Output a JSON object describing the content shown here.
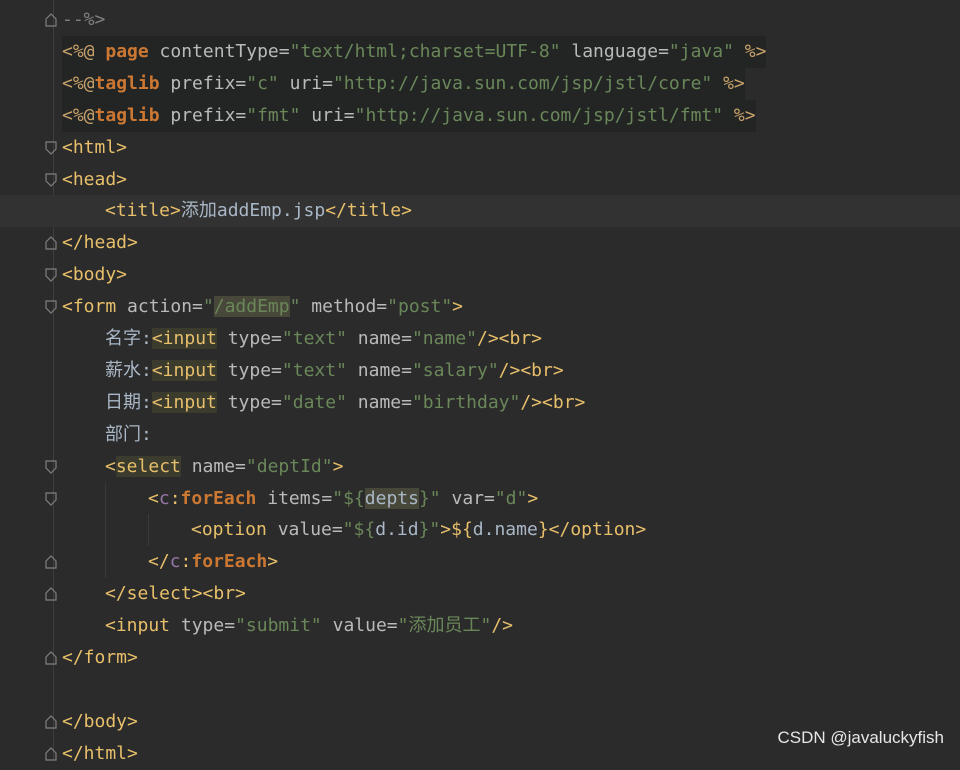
{
  "editor": {
    "lines": [
      {
        "tokens": [
          {
            "t": "--%>",
            "c": "t-comment"
          }
        ]
      },
      {
        "bg": "directive",
        "tokens": [
          {
            "t": "<%@ ",
            "c": "t-pct"
          },
          {
            "t": "page",
            "c": "t-kw"
          },
          {
            "t": " contentType=",
            "c": "t-attr"
          },
          {
            "t": "\"text/html;charset=UTF-8\"",
            "c": "t-str"
          },
          {
            "t": " language=",
            "c": "t-attr"
          },
          {
            "t": "\"java\"",
            "c": "t-str"
          },
          {
            "t": " %>",
            "c": "t-pct"
          }
        ]
      },
      {
        "bg": "directive",
        "tokens": [
          {
            "t": "<%@",
            "c": "t-pct"
          },
          {
            "t": "taglib",
            "c": "t-kw"
          },
          {
            "t": " prefix=",
            "c": "t-attr"
          },
          {
            "t": "\"c\"",
            "c": "t-str"
          },
          {
            "t": " uri=",
            "c": "t-attr"
          },
          {
            "t": "\"http://java.sun.com/jsp/jstl/core\"",
            "c": "t-str"
          },
          {
            "t": " %>",
            "c": "t-pct"
          }
        ]
      },
      {
        "bg": "directive",
        "tokens": [
          {
            "t": "<%@",
            "c": "t-pct"
          },
          {
            "t": "taglib",
            "c": "t-kw"
          },
          {
            "t": " prefix=",
            "c": "t-attr"
          },
          {
            "t": "\"fmt\"",
            "c": "t-str"
          },
          {
            "t": " uri=",
            "c": "t-attr"
          },
          {
            "t": "\"http://java.sun.com/jsp/jstl/fmt\"",
            "c": "t-str"
          },
          {
            "t": " %>",
            "c": "t-pct"
          }
        ]
      },
      {
        "tokens": [
          {
            "t": "<html>",
            "c": "t-tag"
          }
        ]
      },
      {
        "tokens": [
          {
            "t": "<head>",
            "c": "t-tag"
          }
        ]
      },
      {
        "current": true,
        "indent": 1,
        "tokens": [
          {
            "t": "<title>",
            "c": "t-tag"
          },
          {
            "t": "添加",
            "c": "t-text cjk"
          },
          {
            "t": "addEmp.jsp",
            "c": "t-text"
          },
          {
            "t": "</title>",
            "c": "t-tag"
          }
        ]
      },
      {
        "tokens": [
          {
            "t": "</head>",
            "c": "t-tag"
          }
        ]
      },
      {
        "tokens": [
          {
            "t": "<body>",
            "c": "t-tag"
          }
        ]
      },
      {
        "tokens": [
          {
            "t": "<form",
            "c": "t-tag"
          },
          {
            "t": " action=",
            "c": "t-attr"
          },
          {
            "t": "\"",
            "c": "t-str"
          },
          {
            "t": "/addEmp",
            "c": "t-str hl-match"
          },
          {
            "t": "\"",
            "c": "t-str"
          },
          {
            "t": " method=",
            "c": "t-attr"
          },
          {
            "t": "\"post\"",
            "c": "t-str"
          },
          {
            "t": ">",
            "c": "t-tag"
          }
        ]
      },
      {
        "indent": 1,
        "tokens": [
          {
            "t": "名字",
            "c": "t-text cjk"
          },
          {
            "t": ":",
            "c": "t-text"
          },
          {
            "t": "<input",
            "c": "t-tag hl-block"
          },
          {
            "t": " type=",
            "c": "t-attr"
          },
          {
            "t": "\"text\"",
            "c": "t-str"
          },
          {
            "t": " name=",
            "c": "t-attr"
          },
          {
            "t": "\"name\"",
            "c": "t-str"
          },
          {
            "t": "/><br>",
            "c": "t-tag"
          }
        ]
      },
      {
        "indent": 1,
        "tokens": [
          {
            "t": "薪水",
            "c": "t-text cjk"
          },
          {
            "t": ":",
            "c": "t-text"
          },
          {
            "t": "<input",
            "c": "t-tag hl-block"
          },
          {
            "t": " type=",
            "c": "t-attr"
          },
          {
            "t": "\"text\"",
            "c": "t-str"
          },
          {
            "t": " name=",
            "c": "t-attr"
          },
          {
            "t": "\"salary\"",
            "c": "t-str"
          },
          {
            "t": "/><br>",
            "c": "t-tag"
          }
        ]
      },
      {
        "indent": 1,
        "tokens": [
          {
            "t": "日期",
            "c": "t-text cjk"
          },
          {
            "t": ":",
            "c": "t-text"
          },
          {
            "t": "<input",
            "c": "t-tag hl-block"
          },
          {
            "t": " type=",
            "c": "t-attr"
          },
          {
            "t": "\"date\"",
            "c": "t-str"
          },
          {
            "t": " name=",
            "c": "t-attr"
          },
          {
            "t": "\"birthday\"",
            "c": "t-str"
          },
          {
            "t": "/><br>",
            "c": "t-tag"
          }
        ]
      },
      {
        "indent": 1,
        "tokens": [
          {
            "t": "部门",
            "c": "t-text cjk"
          },
          {
            "t": ":",
            "c": "t-text"
          }
        ]
      },
      {
        "indent": 1,
        "tokens": [
          {
            "t": "<",
            "c": "t-tag"
          },
          {
            "t": "select",
            "c": "t-tag hl-block"
          },
          {
            "t": " name=",
            "c": "t-attr"
          },
          {
            "t": "\"deptId\"",
            "c": "t-str"
          },
          {
            "t": ">",
            "c": "t-tag"
          }
        ]
      },
      {
        "indent": 2,
        "tokens": [
          {
            "t": "<",
            "c": "t-tag"
          },
          {
            "t": "c",
            "c": "t-ns"
          },
          {
            "t": ":",
            "c": "t-tag"
          },
          {
            "t": "forEach",
            "c": "t-kw"
          },
          {
            "t": " items=",
            "c": "t-attr"
          },
          {
            "t": "\"${",
            "c": "t-str"
          },
          {
            "t": "depts",
            "c": "t-text hl-match"
          },
          {
            "t": "}\"",
            "c": "t-str"
          },
          {
            "t": " var=",
            "c": "t-attr"
          },
          {
            "t": "\"d\"",
            "c": "t-str"
          },
          {
            "t": ">",
            "c": "t-tag"
          }
        ]
      },
      {
        "indent": 3,
        "tokens": [
          {
            "t": "<option",
            "c": "t-tag"
          },
          {
            "t": " value=",
            "c": "t-attr"
          },
          {
            "t": "\"${",
            "c": "t-str"
          },
          {
            "t": "d.id",
            "c": "t-text"
          },
          {
            "t": "}\"",
            "c": "t-str"
          },
          {
            "t": ">${",
            "c": "t-tag"
          },
          {
            "t": "d.name",
            "c": "t-text"
          },
          {
            "t": "}",
            "c": "t-tag"
          },
          {
            "t": "</option>",
            "c": "t-tag"
          }
        ]
      },
      {
        "indent": 2,
        "tokens": [
          {
            "t": "</",
            "c": "t-tag"
          },
          {
            "t": "c",
            "c": "t-ns"
          },
          {
            "t": ":",
            "c": "t-tag"
          },
          {
            "t": "forEach",
            "c": "t-kw"
          },
          {
            "t": ">",
            "c": "t-tag"
          }
        ]
      },
      {
        "indent": 1,
        "tokens": [
          {
            "t": "</select><br>",
            "c": "t-tag"
          }
        ]
      },
      {
        "indent": 1,
        "tokens": [
          {
            "t": "<input",
            "c": "t-tag"
          },
          {
            "t": " type=",
            "c": "t-attr"
          },
          {
            "t": "\"submit\"",
            "c": "t-str"
          },
          {
            "t": " value=",
            "c": "t-attr"
          },
          {
            "t": "\"",
            "c": "t-str"
          },
          {
            "t": "添加员工",
            "c": "t-str cjk"
          },
          {
            "t": "\"",
            "c": "t-str"
          },
          {
            "t": "/>",
            "c": "t-tag"
          }
        ]
      },
      {
        "tokens": [
          {
            "t": "</form>",
            "c": "t-tag"
          }
        ]
      },
      {
        "tokens": []
      },
      {
        "tokens": [
          {
            "t": "</body>",
            "c": "t-tag"
          }
        ]
      },
      {
        "tokens": [
          {
            "t": "</html>",
            "c": "t-tag"
          }
        ]
      }
    ]
  },
  "watermark": "CSDN @javaluckyfish",
  "colors": {
    "background": "#2b2b2b",
    "tag": "#e8bf6a",
    "string": "#6a8759",
    "keyword": "#cc7832",
    "text": "#a9b7c6"
  }
}
